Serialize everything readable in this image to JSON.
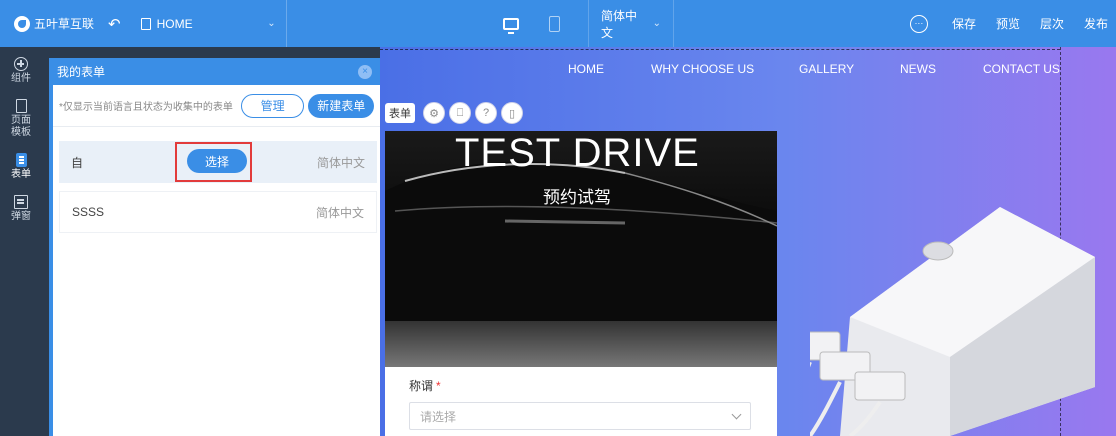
{
  "topbar": {
    "brand": "五叶草互联",
    "undo_symbol": "↶",
    "page_select": "HOME",
    "language": "简体中文",
    "actions": {
      "save": "保存",
      "preview": "预览",
      "layers": "层次",
      "publish": "发布"
    }
  },
  "sidebar": {
    "items": [
      {
        "label": "组件"
      },
      {
        "label": "页面\n模板"
      },
      {
        "label": "表单"
      },
      {
        "label": "弹窗"
      }
    ]
  },
  "canvas": {
    "nav": [
      "HOME",
      "WHY CHOOSE US",
      "GALLERY",
      "NEWS",
      "CONTACT US"
    ],
    "toolbar_label": "表单",
    "hero_title": "TEST DRIVE",
    "hero_subtitle": "预约试驾",
    "form_field_label": "称谓",
    "required_mark": "*",
    "select_placeholder": "请选择"
  },
  "panel": {
    "title": "我的表单",
    "close_symbol": "×",
    "note": "*仅显示当前语言且状态为收集中的表单",
    "manage_button": "管理",
    "new_button": "新建表单",
    "forms": [
      {
        "name": "自",
        "language": "简体中文",
        "action": "选择"
      },
      {
        "name": "SSSS",
        "language": "简体中文"
      }
    ]
  },
  "colors": {
    "primary": "#3a8ee6",
    "sidebar": "#2b3a4d",
    "highlight": "#e23b3b"
  }
}
